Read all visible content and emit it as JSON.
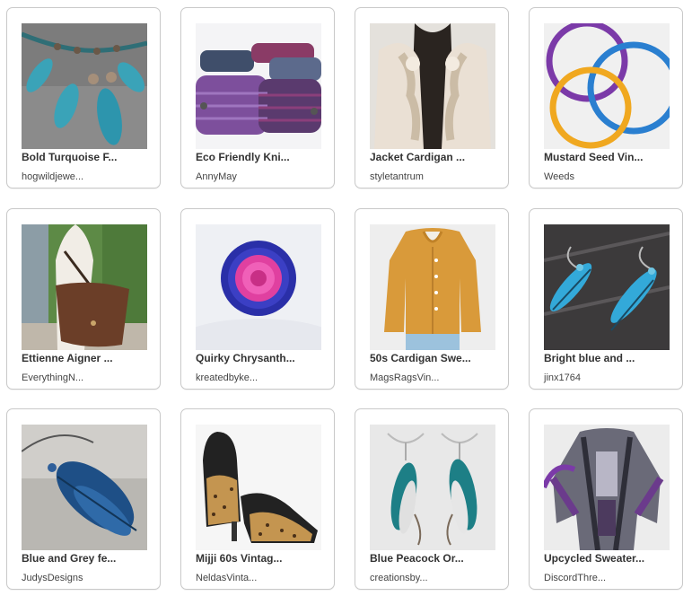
{
  "listings": [
    {
      "title": "Bold Turquoise F...",
      "shop": "hogwildjewe..."
    },
    {
      "title": "Eco Friendly Kni...",
      "shop": "AnnyMay"
    },
    {
      "title": "Jacket Cardigan ...",
      "shop": "styletantrum"
    },
    {
      "title": "Mustard Seed Vin...",
      "shop": "Weeds"
    },
    {
      "title": "Ettienne Aigner ...",
      "shop": "EverythingN..."
    },
    {
      "title": "Quirky Chrysanth...",
      "shop": "kreatedbyke..."
    },
    {
      "title": "50s Cardigan Swe...",
      "shop": "MagsRagsVin..."
    },
    {
      "title": "Bright blue and ...",
      "shop": "jinx1764"
    },
    {
      "title": "Blue and Grey fe...",
      "shop": "JudysDesigns"
    },
    {
      "title": "Mijji 60s Vintag...",
      "shop": "NeldasVinta..."
    },
    {
      "title": "Blue Peacock Or...",
      "shop": "creationsby..."
    },
    {
      "title": "Upcycled Sweater...",
      "shop": "DiscordThre..."
    }
  ]
}
